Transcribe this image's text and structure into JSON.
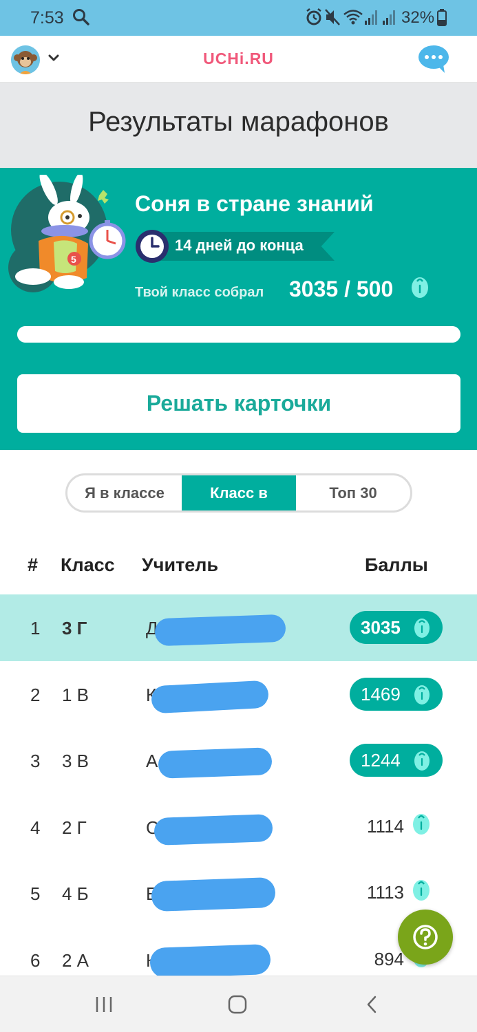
{
  "status_bar": {
    "time": "7:53",
    "battery_percent": "32%",
    "icons": [
      "search-icon",
      "alarm-icon",
      "mute-icon",
      "wifi-icon",
      "signal-icon",
      "signal-icon",
      "battery-icon"
    ]
  },
  "app_bar": {
    "logo": "UCHi.RU",
    "logo_color": "#f0587a",
    "icons": [
      "avatar-monkey-icon",
      "chevron-down-icon",
      "chat-bubble-icon"
    ]
  },
  "page": {
    "title": "Результаты марафонов"
  },
  "marathon": {
    "name": "Соня в стране знаний",
    "deadline": "14 дней до конца",
    "collected_label": "Твой класс собрал",
    "collected_value": "3035 / 500",
    "progress_fraction": 1.0,
    "solve_button": "Решать карточки",
    "accent_color": "#00ae9e",
    "icons": [
      "rabbit-clock-illustration",
      "clock-icon",
      "egg-icon"
    ]
  },
  "tabs": [
    {
      "label": "Я в классе",
      "active": false
    },
    {
      "label": "Класс в",
      "active": true
    },
    {
      "label": "Топ 30",
      "active": false
    }
  ],
  "table": {
    "headers": {
      "rank": "#",
      "class": "Класс",
      "teacher": "Учитель",
      "points": "Баллы"
    },
    "rows": [
      {
        "rank": "1",
        "class": "3 Г",
        "teacher": "Д             Г. А.",
        "points": "3035",
        "highlighted": true,
        "badge": true
      },
      {
        "rank": "2",
        "class": "1 В",
        "teacher": "Ка             С.",
        "points": "1469",
        "highlighted": false,
        "badge": true
      },
      {
        "rank": "3",
        "class": "3 В",
        "teacher": "А              А.",
        "points": "1244",
        "highlighted": false,
        "badge": true
      },
      {
        "rank": "4",
        "class": "2 Г",
        "teacher": "С              В.",
        "points": "1114",
        "highlighted": false,
        "badge": false
      },
      {
        "rank": "5",
        "class": "4 Б",
        "teacher": "Е             . А.",
        "points": "1113",
        "highlighted": false,
        "badge": false
      },
      {
        "rank": "6",
        "class": "2 А",
        "teacher": "К              .",
        "points": "894",
        "highlighted": false,
        "badge": false
      }
    ]
  },
  "help_button": {
    "icon": "question-icon",
    "color": "#7aa51a"
  },
  "nav_bar": {
    "icons": [
      "recent-apps-icon",
      "home-icon",
      "back-icon"
    ]
  }
}
